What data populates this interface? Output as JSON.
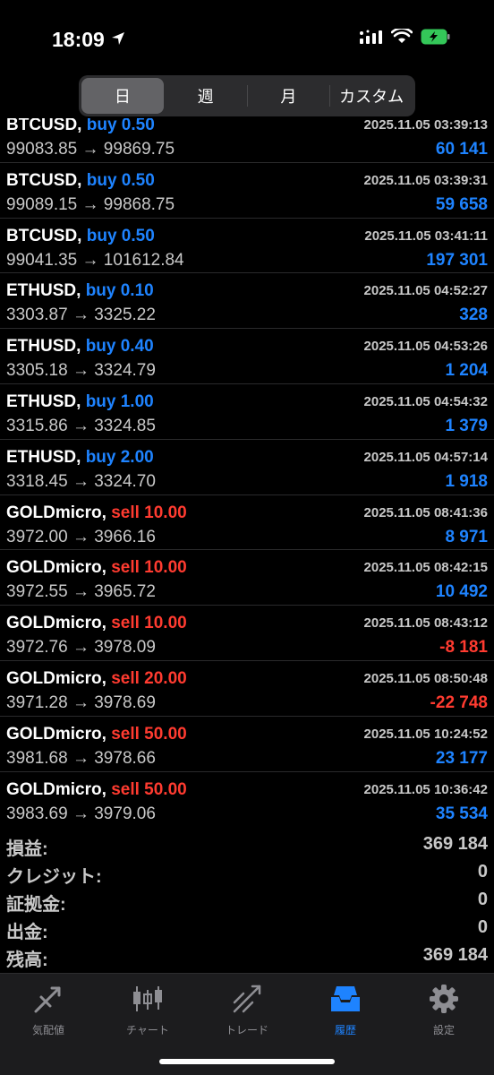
{
  "status": {
    "time": "18:09"
  },
  "segments": [
    {
      "label": "日",
      "active": true
    },
    {
      "label": "週",
      "active": false
    },
    {
      "label": "月",
      "active": false
    },
    {
      "label": "カスタム",
      "active": false
    }
  ],
  "deals": [
    {
      "symbol": "BTCUSD,",
      "side": "buy",
      "side_label": "buy 0.50",
      "time": "2025.11.05 03:39:13",
      "prices": "99083.85 → 99869.75",
      "profit": "60 141",
      "profit_sign": "pos"
    },
    {
      "symbol": "BTCUSD,",
      "side": "buy",
      "side_label": "buy 0.50",
      "time": "2025.11.05 03:39:31",
      "prices": "99089.15 → 99868.75",
      "profit": "59 658",
      "profit_sign": "pos"
    },
    {
      "symbol": "BTCUSD,",
      "side": "buy",
      "side_label": "buy 0.50",
      "time": "2025.11.05 03:41:11",
      "prices": "99041.35 → 101612.84",
      "profit": "197 301",
      "profit_sign": "pos"
    },
    {
      "symbol": "ETHUSD,",
      "side": "buy",
      "side_label": "buy 0.10",
      "time": "2025.11.05 04:52:27",
      "prices": "3303.87 → 3325.22",
      "profit": "328",
      "profit_sign": "pos"
    },
    {
      "symbol": "ETHUSD,",
      "side": "buy",
      "side_label": "buy 0.40",
      "time": "2025.11.05 04:53:26",
      "prices": "3305.18 → 3324.79",
      "profit": "1 204",
      "profit_sign": "pos"
    },
    {
      "symbol": "ETHUSD,",
      "side": "buy",
      "side_label": "buy 1.00",
      "time": "2025.11.05 04:54:32",
      "prices": "3315.86 → 3324.85",
      "profit": "1 379",
      "profit_sign": "pos"
    },
    {
      "symbol": "ETHUSD,",
      "side": "buy",
      "side_label": "buy 2.00",
      "time": "2025.11.05 04:57:14",
      "prices": "3318.45 → 3324.70",
      "profit": "1 918",
      "profit_sign": "pos"
    },
    {
      "symbol": "GOLDmicro,",
      "side": "sell",
      "side_label": "sell 10.00",
      "time": "2025.11.05 08:41:36",
      "prices": "3972.00 → 3966.16",
      "profit": "8 971",
      "profit_sign": "pos"
    },
    {
      "symbol": "GOLDmicro,",
      "side": "sell",
      "side_label": "sell 10.00",
      "time": "2025.11.05 08:42:15",
      "prices": "3972.55 → 3965.72",
      "profit": "10 492",
      "profit_sign": "pos"
    },
    {
      "symbol": "GOLDmicro,",
      "side": "sell",
      "side_label": "sell 10.00",
      "time": "2025.11.05 08:43:12",
      "prices": "3972.76 → 3978.09",
      "profit": "-8 181",
      "profit_sign": "neg"
    },
    {
      "symbol": "GOLDmicro,",
      "side": "sell",
      "side_label": "sell 20.00",
      "time": "2025.11.05 08:50:48",
      "prices": "3971.28 → 3978.69",
      "profit": "-22 748",
      "profit_sign": "neg"
    },
    {
      "symbol": "GOLDmicro,",
      "side": "sell",
      "side_label": "sell 50.00",
      "time": "2025.11.05 10:24:52",
      "prices": "3981.68 → 3978.66",
      "profit": "23 177",
      "profit_sign": "pos"
    },
    {
      "symbol": "GOLDmicro,",
      "side": "sell",
      "side_label": "sell 50.00",
      "time": "2025.11.05 10:36:42",
      "prices": "3983.69 → 3979.06",
      "profit": "35 534",
      "profit_sign": "pos"
    }
  ],
  "summary": [
    {
      "label": "損益:",
      "value": "369 184"
    },
    {
      "label": "クレジット:",
      "value": "0"
    },
    {
      "label": "証拠金:",
      "value": "0"
    },
    {
      "label": "出金:",
      "value": "0"
    },
    {
      "label": "残高:",
      "value": "369 184"
    }
  ],
  "tabs": [
    {
      "label": "気配値",
      "icon": "quotes-icon",
      "active": false
    },
    {
      "label": "チャート",
      "icon": "chart-icon",
      "active": false
    },
    {
      "label": "トレード",
      "icon": "trade-icon",
      "active": false
    },
    {
      "label": "履歴",
      "icon": "history-icon",
      "active": true
    },
    {
      "label": "設定",
      "icon": "settings-icon",
      "active": false
    }
  ],
  "colors": {
    "buy": "#1e83ff",
    "sell": "#ff3b30",
    "active_tab": "#1e83ff",
    "inactive": "#8e8e93"
  }
}
